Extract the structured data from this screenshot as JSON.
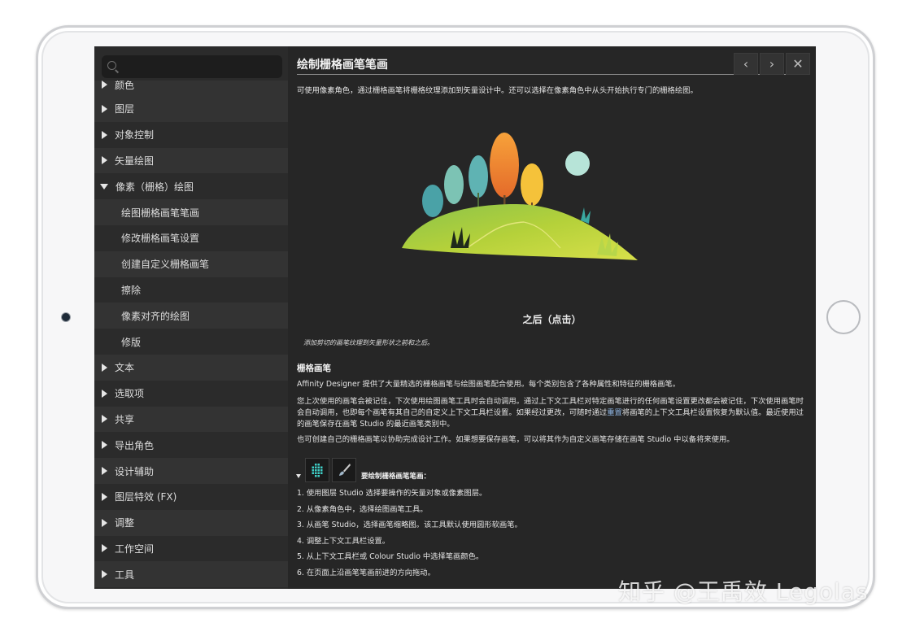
{
  "sidebar": {
    "search_placeholder": "",
    "clipped_item": "颜色",
    "items": [
      {
        "label": "图层",
        "kind": "collapsed"
      },
      {
        "label": "对象控制",
        "kind": "collapsed"
      },
      {
        "label": "矢量绘图",
        "kind": "collapsed"
      },
      {
        "label": "像素（栅格）绘图",
        "kind": "expanded"
      },
      {
        "label": "绘图栅格画笔笔画",
        "kind": "child"
      },
      {
        "label": "修改栅格画笔设置",
        "kind": "child"
      },
      {
        "label": "创建自定义栅格画笔",
        "kind": "child"
      },
      {
        "label": "擦除",
        "kind": "child"
      },
      {
        "label": "像素对齐的绘图",
        "kind": "child"
      },
      {
        "label": "修版",
        "kind": "child"
      },
      {
        "label": "文本",
        "kind": "collapsed"
      },
      {
        "label": "选取项",
        "kind": "collapsed"
      },
      {
        "label": "共享",
        "kind": "collapsed"
      },
      {
        "label": "导出角色",
        "kind": "collapsed"
      },
      {
        "label": "设计辅助",
        "kind": "collapsed"
      },
      {
        "label": "图层特效 (FX)",
        "kind": "collapsed"
      },
      {
        "label": "调整",
        "kind": "collapsed"
      },
      {
        "label": "工作空间",
        "kind": "collapsed"
      },
      {
        "label": "工具",
        "kind": "collapsed"
      }
    ]
  },
  "content": {
    "title": "绘制栅格画笔笔画",
    "nav_buttons": {
      "back": "‹",
      "forward": "›",
      "close": "✕"
    },
    "intro": "可使用像素角色，通过栅格画笔将栅格纹理添加到矢量设计中。还可以选择在像素角色中从头开始执行专门的栅格绘图。",
    "caption_after": "之后（点击）",
    "caption_small": "添加剪切的画笔纹理到矢量形状之前和之后。",
    "section_heading": "栅格画笔",
    "para1": "Affinity Designer 提供了大量精选的栅格画笔与绘图画笔配合使用。每个类别包含了各种属性和特征的栅格画笔。",
    "para2_before": "您上次使用的画笔会被记住，下次使用绘图画笔工具时会自动调用。通过上下文工具栏对特定画笔进行的任何画笔设置更改都会被记住，下次使用画笔时会自动调用，也即每个画笔有其自己的自定义上下文工具栏设置。如果经过更改，可随时通过",
    "para2_link": "重置",
    "para2_after": "将画笔的上下文工具栏设置恢复为默认值。最近使用过的画笔保存在画笔 Studio 的最近画笔类别中。",
    "para3": "也可创建自己的栅格画笔以协助完成设计工作。如果想要保存画笔，可以将其作为自定义画笔存储在画笔 Studio 中以备将来使用。",
    "tools_label": "要绘制栅格画笔笔画：",
    "steps": [
      "1.  使用图层 Studio 选择要操作的矢量对象或像素图层。",
      "2.  从像素角色中，选择绘图画笔工具。",
      "3.  从画笔 Studio，选择画笔缩略图。该工具默认使用圆形软画笔。",
      "4.  调整上下文工具栏设置。",
      "5.  从上下文工具栏或 Colour Studio 中选择笔画颜色。",
      "6.  在页面上沿画笔笔画前进的方向拖动。"
    ]
  },
  "watermark": "知乎 @王禹效 Legolas",
  "colors": {
    "screen_bg": "#262626",
    "sidebar_bg": "#2b2b2b",
    "sidebar_alt": "#333333",
    "link": "#8db4e2"
  }
}
